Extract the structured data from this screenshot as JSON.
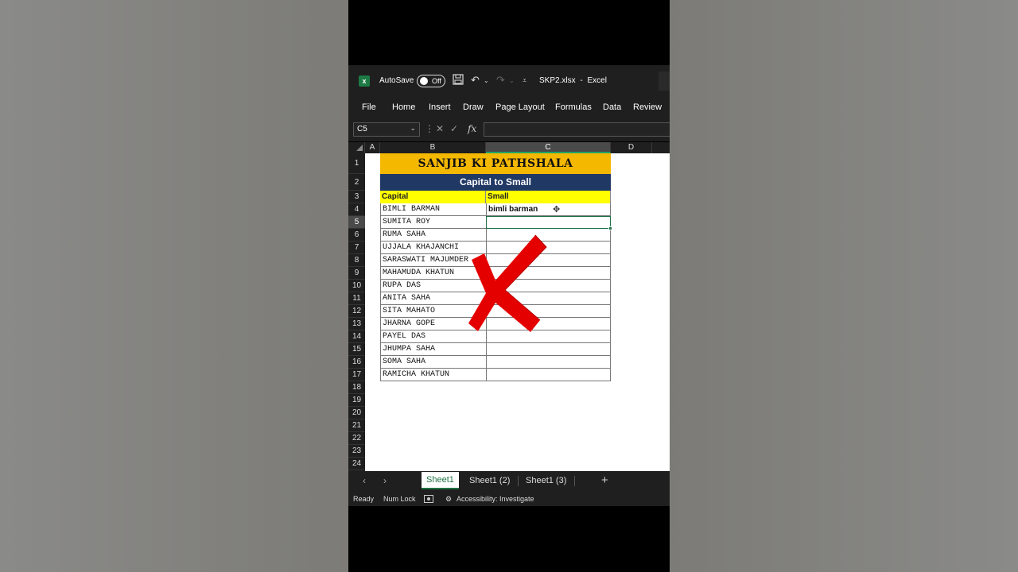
{
  "window": {
    "autosave_label": "AutoSave",
    "autosave_state": "Off",
    "filename": "SKP2.xlsx",
    "separator": "-",
    "app_name": "Excel"
  },
  "ribbon": {
    "tabs": [
      "File",
      "Home",
      "Insert",
      "Draw",
      "Page Layout",
      "Formulas",
      "Data",
      "Review"
    ]
  },
  "formula_bar": {
    "name_box": "C5",
    "fx_label": "fx",
    "formula_value": ""
  },
  "columns": [
    "A",
    "B",
    "C",
    "D"
  ],
  "selected_column": "C",
  "rows": [
    "1",
    "2",
    "3",
    "4",
    "5",
    "6",
    "7",
    "8",
    "9",
    "10",
    "11",
    "12",
    "13",
    "14",
    "15",
    "16",
    "17",
    "18",
    "19",
    "20",
    "21",
    "22",
    "23",
    "24"
  ],
  "selected_row": "5",
  "sheet": {
    "title": "SANJIB KI PATHSHALA",
    "subtitle": "Capital to Small",
    "header_capital": "Capital",
    "header_small": "Small",
    "names": [
      "BIMLI BARMAN",
      "SUMITA ROY",
      "RUMA SAHA",
      "UJJALA KHAJANCHI",
      "SARASWATI MAJUMDER",
      "MAHAMUDA KHATUN",
      "RUPA DAS",
      "ANITA SAHA",
      "SITA MAHATO",
      "JHARNA GOPE",
      "PAYEL DAS",
      "JHUMPA SAHA",
      "SOMA SAHA",
      "RAMICHA KHATUN"
    ],
    "small_values": [
      "bimli barman",
      "",
      "",
      "",
      "",
      "",
      "",
      "",
      "",
      "",
      "",
      "",
      "",
      ""
    ],
    "overlay_mark": "red-x"
  },
  "sheet_tabs": [
    "Sheet1",
    "Sheet1 (2)",
    "Sheet1 (3)"
  ],
  "active_sheet": "Sheet1",
  "add_sheet": "+",
  "nav_prev": "‹",
  "nav_next": "›",
  "status": {
    "ready": "Ready",
    "num_lock": "Num Lock",
    "accessibility": "Accessibility: Investigate"
  },
  "colors": {
    "title_bg": "#f5b800",
    "subtitle_bg": "#203864",
    "header_bg": "#ffff00",
    "excel_green": "#1e7145",
    "x_mark": "#e50000"
  }
}
